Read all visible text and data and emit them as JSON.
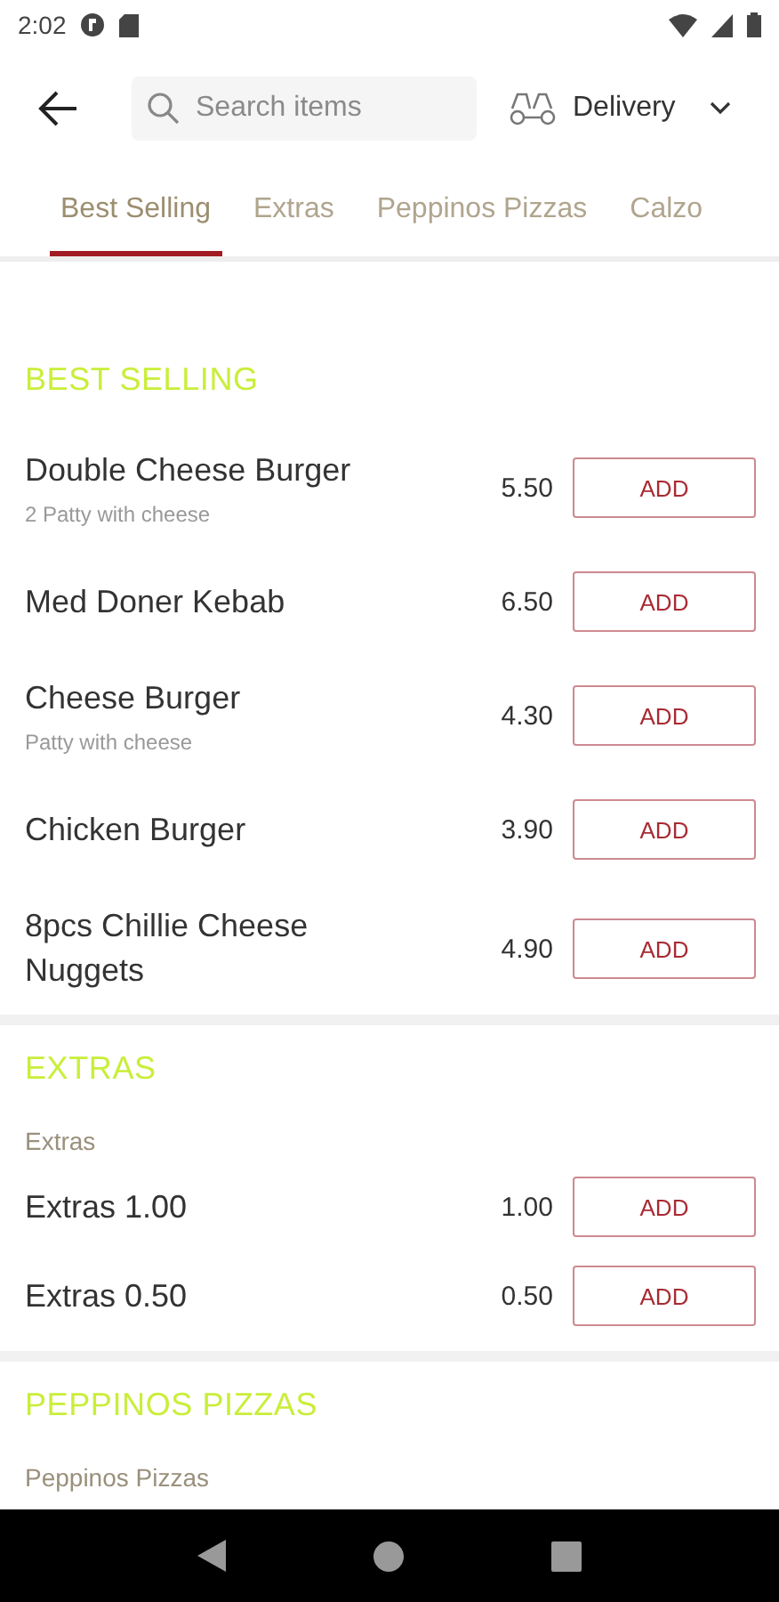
{
  "status_bar": {
    "time": "2:02"
  },
  "header": {
    "search": {
      "placeholder": "Search items"
    },
    "mode": {
      "label": "Delivery"
    }
  },
  "tabs": [
    {
      "label": "Best Selling",
      "selected": true
    },
    {
      "label": "Extras",
      "selected": false
    },
    {
      "label": "Peppinos Pizzas",
      "selected": false
    },
    {
      "label": "Calzo",
      "selected": false
    }
  ],
  "sections": [
    {
      "title": "BEST SELLING",
      "items": [
        {
          "name": "Double Cheese Burger",
          "description": "2 Patty with cheese",
          "price": "5.50",
          "button": "ADD"
        },
        {
          "name": "Med Doner Kebab",
          "price": "6.50",
          "button": "ADD"
        },
        {
          "name": "Cheese Burger",
          "description": "Patty with cheese",
          "price": "4.30",
          "button": "ADD"
        },
        {
          "name": "Chicken Burger",
          "price": "3.90",
          "button": "ADD"
        },
        {
          "name": "8pcs Chillie Cheese Nuggets",
          "price": "4.90",
          "button": "ADD"
        }
      ]
    },
    {
      "title": "EXTRAS",
      "subtitle": "Extras",
      "items": [
        {
          "name": "Extras 1.00",
          "price": "1.00",
          "button": "ADD"
        },
        {
          "name": "Extras 0.50",
          "price": "0.50",
          "button": "ADD"
        }
      ]
    },
    {
      "title": "PEPPINOS PIZZAS",
      "subtitle": "Peppinos Pizzas"
    }
  ]
}
